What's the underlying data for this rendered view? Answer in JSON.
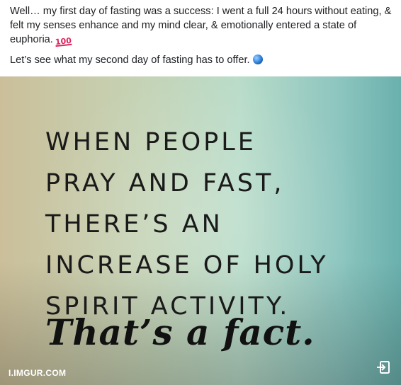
{
  "post": {
    "paragraph1": "Well… my first day of fasting was a success: I went a full 24 hours without eating, & felt my senses enhance and my mind clear, & emotionally entered a state of euphoria.",
    "paragraph1_emoji": "hundred-points-emoji",
    "paragraph2": "Let’s see what my second day of fasting has to offer.",
    "paragraph2_emoji": "globe-emoji"
  },
  "media": {
    "quote_lines": [
      "WHEN PEOPLE",
      "PRAY AND FAST,",
      "THERE’S AN",
      "INCREASE OF HOLY",
      "SPIRIT ACTIVITY."
    ],
    "tagline": "That’s a fact.",
    "source": "I.IMGUR.COM",
    "open_icon": "open-external-icon"
  },
  "colors": {
    "text": "#1c1e21",
    "link_text": "#ffffff",
    "image_bg_left": "#cbbf9a",
    "image_bg_right": "#6ab0ad"
  }
}
